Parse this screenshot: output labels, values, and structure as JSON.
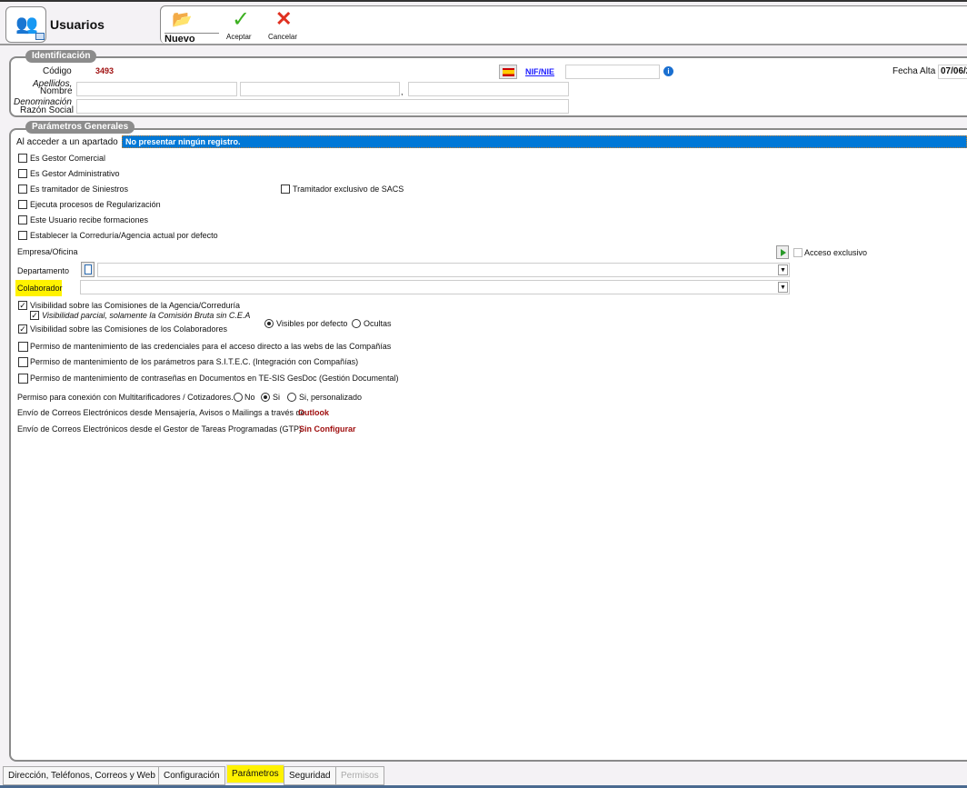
{
  "header": {
    "title": "Usuarios",
    "toolbar": {
      "new": "Nuevo",
      "accept": "Aceptar",
      "cancel": "Cancelar"
    }
  },
  "identificacion": {
    "legend": "Identificación",
    "codigo_label": "Código",
    "codigo_value": "3493",
    "apellidos_label": "Apellidos,",
    "nombre_label": "Nombre",
    "comma": ",",
    "denominacion_label": "Denominación",
    "razon_label": "Razón Social",
    "nif_link": "NIF/NIE",
    "fecha_label": "Fecha Alta",
    "fecha_value": "07/06/2"
  },
  "parametros": {
    "legend": "Parámetros Generales",
    "acceder_label": "Al acceder a un apartado",
    "acceder_value": "No presentar ningún registro.",
    "checks": [
      {
        "label": "Es Gestor Comercial",
        "checked": false
      },
      {
        "label": "Es Gestor Administrativo",
        "checked": false
      },
      {
        "label": "Es tramitador de Siniestros",
        "checked": false
      },
      {
        "label": "Ejecuta procesos de Regularización",
        "checked": false
      },
      {
        "label": "Este Usuario recibe formaciones",
        "checked": false
      },
      {
        "label": "Establecer la Correduría/Agencia actual por defecto",
        "checked": false
      }
    ],
    "sacs": {
      "label": "Tramitador exclusivo de SACS",
      "checked": false
    },
    "empresa_label": "Empresa/Oficina",
    "acceso_exclusivo": "Acceso exclusivo",
    "departamento_label": "Departamento",
    "colaborador_label": "Colaborador",
    "vis1": {
      "label": "Visibilidad sobre las Comisiones de la Agencia/Correduría",
      "checked": true
    },
    "vis2": {
      "label": "Visibilidad parcial, solamente la Comisión Bruta sin C.E.A",
      "checked": true
    },
    "vis3": {
      "label": "Visibilidad sobre las Comisiones de los Colaboradores",
      "checked": true
    },
    "vis_radios": {
      "selected": "Visibles por defecto",
      "options": [
        "Visibles por defecto",
        "Ocultas"
      ]
    },
    "permisos": [
      {
        "label": "Permiso de mantenimiento de las credenciales para el acceso directo a las webs de las Compañías",
        "checked": false
      },
      {
        "label": "Permiso de mantenimiento de los parámetros para S.I.T.E.C. (Integración con Compañías)",
        "checked": false
      },
      {
        "label": "Permiso de mantenimiento de contraseñas en Documentos en TE-SIS GesDoc (Gestión Documental)",
        "checked": false
      }
    ],
    "conexion": {
      "label": "Permiso para conexión con Multitarificadores / Cotizadores.",
      "options": [
        "No",
        "Si",
        "Si, personalizado"
      ],
      "selected": "Si"
    },
    "correo1": {
      "label": "Envío de Correos Electrónicos desde Mensajería, Avisos o Mailings a través de",
      "value": "Outlook"
    },
    "correo2": {
      "label": "Envío de Correos Electrónicos desde el Gestor de Tareas Programadas (GTP)",
      "value": "Sin Configurar"
    }
  },
  "tabs": [
    {
      "label": "Dirección, Teléfonos, Correos y Web"
    },
    {
      "label": "Configuración"
    },
    {
      "label": "Parámetros",
      "active": true
    },
    {
      "label": "Seguridad"
    },
    {
      "label": "Permisos",
      "disabled": true
    }
  ],
  "colors": {
    "highlight": "#fff200",
    "selection": "#0078d7",
    "value_red": "#a01010",
    "link": "#1a1aff"
  }
}
